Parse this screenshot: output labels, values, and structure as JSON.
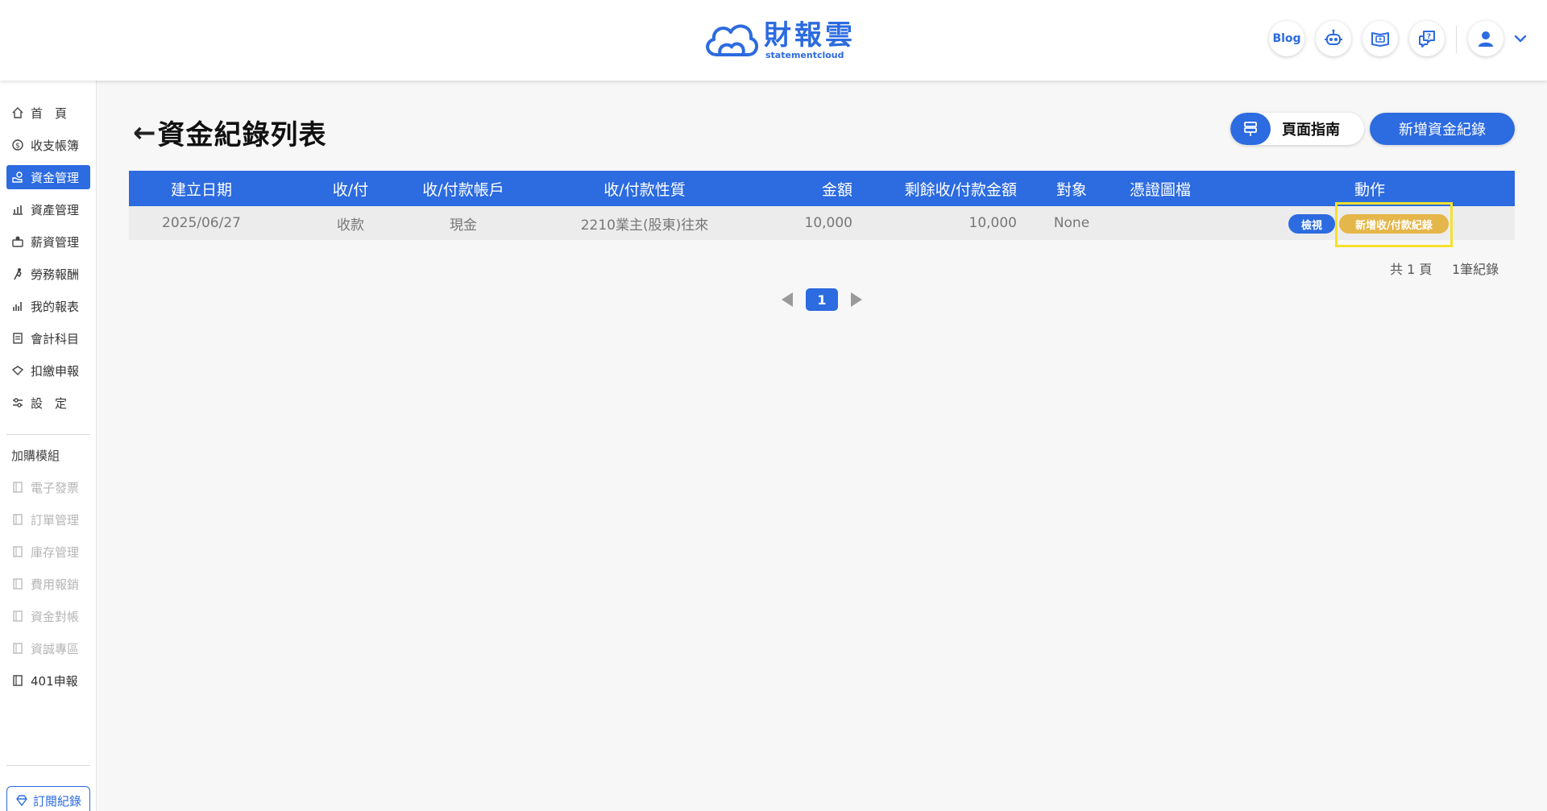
{
  "brand": {
    "name": "財報雲",
    "subtitle": "statementcloud"
  },
  "header": {
    "blog_label": "Blog",
    "icons": [
      "robot-icon",
      "video-guide-icon",
      "help-chat-icon",
      "user-avatar-icon",
      "chevron-down-icon"
    ]
  },
  "sidebar": {
    "items": [
      {
        "label": "首　頁",
        "icon": "home-icon"
      },
      {
        "label": "收支帳簿",
        "icon": "coin-icon"
      },
      {
        "label": "資金管理",
        "icon": "money-hand-icon",
        "active": true
      },
      {
        "label": "資產管理",
        "icon": "asset-icon"
      },
      {
        "label": "薪資管理",
        "icon": "salary-icon"
      },
      {
        "label": "勞務報酬",
        "icon": "labor-icon"
      },
      {
        "label": "我的報表",
        "icon": "report-chart-icon"
      },
      {
        "label": "會計科目",
        "icon": "ledger-icon"
      },
      {
        "label": "扣繳申報",
        "icon": "withholding-icon"
      },
      {
        "label": "設　定",
        "icon": "settings-icon"
      }
    ],
    "section_title": "加購模組",
    "addons": [
      {
        "label": "電子發票",
        "enabled": false
      },
      {
        "label": "訂單管理",
        "enabled": false
      },
      {
        "label": "庫存管理",
        "enabled": false
      },
      {
        "label": "費用報銷",
        "enabled": false
      },
      {
        "label": "資金對帳",
        "enabled": false
      },
      {
        "label": "資誠專區",
        "enabled": false
      },
      {
        "label": "401申報",
        "enabled": true
      }
    ],
    "subscription_label": "訂閱紀錄"
  },
  "main": {
    "back_arrow": "←",
    "title": "資金紀錄列表",
    "guide_label": "頁面指南",
    "add_label": "新增資金紀錄",
    "table": {
      "columns": [
        "建立日期",
        "收/付",
        "收/付款帳戶",
        "收/付款性質",
        "金額",
        "剩餘收/付款金額",
        "對象",
        "憑證圖檔",
        "動作"
      ],
      "rows": [
        {
          "date": "2025/06/27",
          "type": "收款",
          "account": "現金",
          "nature": "2210業主(股東)往來",
          "amount": "10,000",
          "remaining": "10,000",
          "party": "None",
          "attachment": "",
          "view_label": "檢視",
          "add_record_label": "新增收/付款紀錄"
        }
      ]
    },
    "pagination": {
      "total_pages": "共 1 頁",
      "total_records": "1筆紀錄",
      "current_page": "1"
    }
  },
  "colors": {
    "primary": "#2c6be0",
    "accent": "#e5b649",
    "highlight": "#f5e12a"
  }
}
